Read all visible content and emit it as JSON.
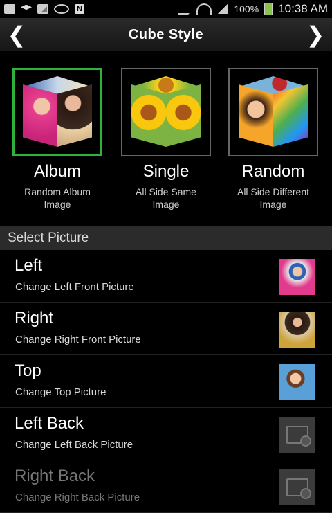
{
  "status": {
    "battery": "100%",
    "time": "10:38 AM"
  },
  "header": {
    "title": "Cube Style",
    "left_arrow": "❮",
    "right_arrow": "❯"
  },
  "styles": [
    {
      "label": "Album",
      "sub": "Random Album\nImage",
      "selected": true
    },
    {
      "label": "Single",
      "sub": "All Side Same\nImage",
      "selected": false
    },
    {
      "label": "Random",
      "sub": "All Side Different\nImage",
      "selected": false
    }
  ],
  "section": {
    "title": "Select Picture"
  },
  "pictures": [
    {
      "title": "Left",
      "sub": "Change Left Front Picture",
      "thumb": "pink-photo"
    },
    {
      "title": "Right",
      "sub": "Change Right Front Picture",
      "thumb": "yellow-photo"
    },
    {
      "title": "Top",
      "sub": "Change Top Picture",
      "thumb": "blue-photo"
    },
    {
      "title": "Left Back",
      "sub": "Change Left Back Picture",
      "thumb": "placeholder"
    },
    {
      "title": "Right Back",
      "sub": "Change Right Back Picture",
      "thumb": "placeholder"
    }
  ],
  "colors": {
    "selected_border": "#2fb23a",
    "section_bg": "#2b2b2b"
  }
}
